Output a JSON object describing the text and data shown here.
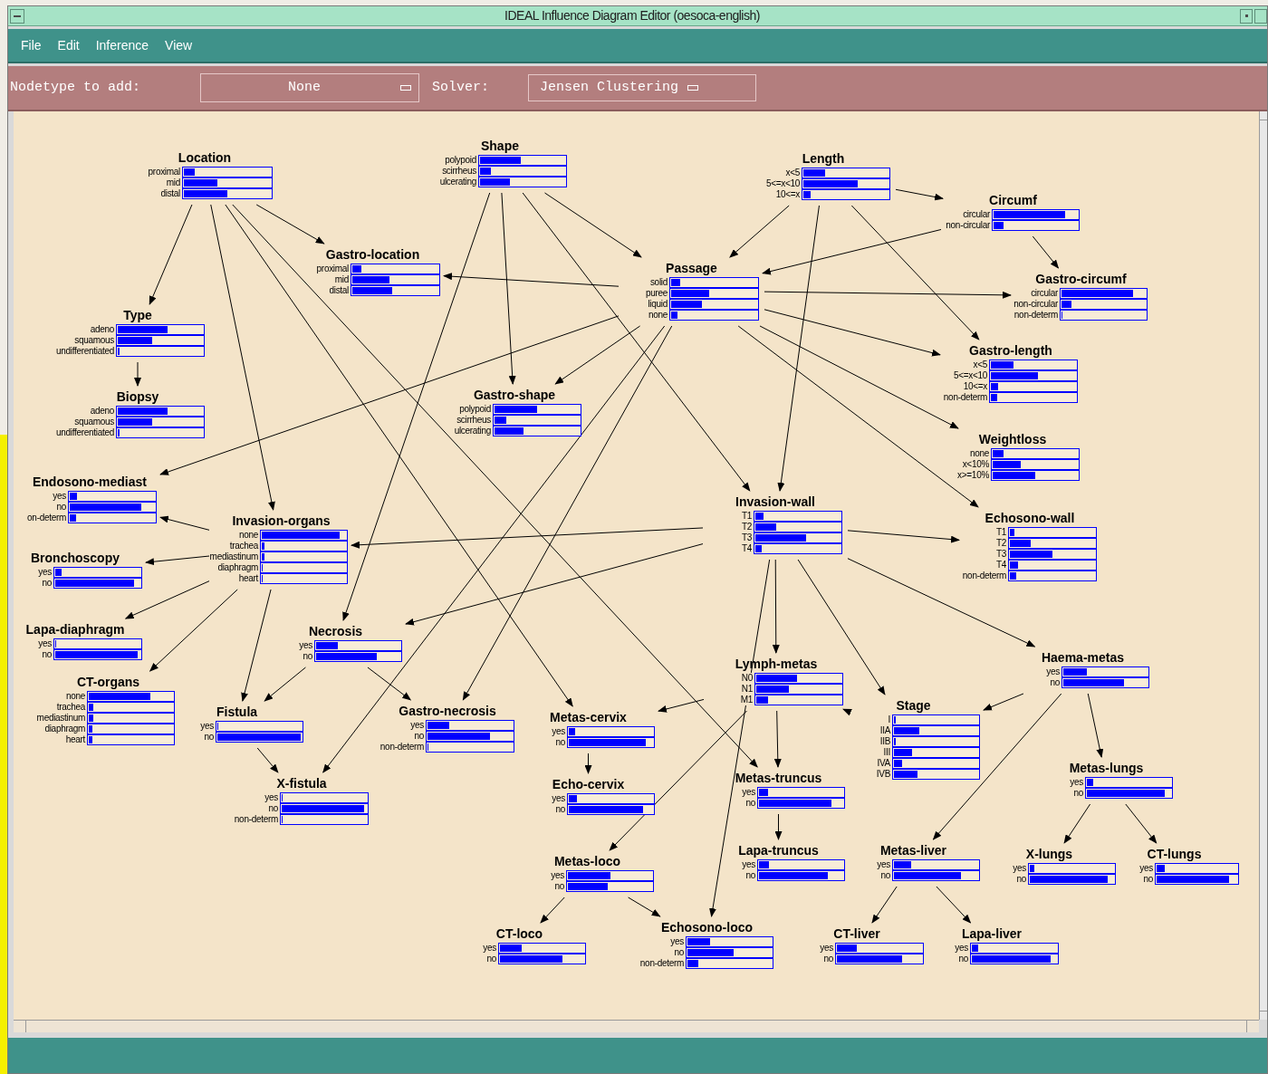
{
  "window": {
    "title": "IDEAL Influence Diagram Editor (oesoca-english)"
  },
  "menu": [
    "File",
    "Edit",
    "Inference",
    "View"
  ],
  "toolbar": {
    "nodetype_label": "Nodetype to add:",
    "nodetype_value": "None",
    "solver_label": "Solver:",
    "solver_value": "Jensen Clustering"
  },
  "nodes": [
    {
      "name": "Location",
      "states": [
        {
          "label": "proximal",
          "level": 0.12
        },
        {
          "label": "mid",
          "level": 0.39
        },
        {
          "label": "distal",
          "level": 0.5
        }
      ]
    },
    {
      "name": "Shape",
      "states": [
        {
          "label": "polypoid",
          "level": 0.48
        },
        {
          "label": "scirrheus",
          "level": 0.13
        },
        {
          "label": "ulcerating",
          "level": 0.35
        }
      ]
    },
    {
      "name": "Length",
      "states": [
        {
          "label": "x<5",
          "level": 0.25
        },
        {
          "label": "5<=x<10",
          "level": 0.64
        },
        {
          "label": "10<=x",
          "level": 0.09
        }
      ]
    },
    {
      "name": "Circumf",
      "states": [
        {
          "label": "circular",
          "level": 0.85
        },
        {
          "label": "non-circular",
          "level": 0.12
        }
      ]
    },
    {
      "name": "Gastro-location",
      "states": [
        {
          "label": "proximal",
          "level": 0.1
        },
        {
          "label": "mid",
          "level": 0.43
        },
        {
          "label": "distal",
          "level": 0.46
        }
      ]
    },
    {
      "name": "Type",
      "states": [
        {
          "label": "adeno",
          "level": 0.58
        },
        {
          "label": "squamous",
          "level": 0.4
        },
        {
          "label": "undifferentiated",
          "level": 0.02
        }
      ]
    },
    {
      "name": "Passage",
      "states": [
        {
          "label": "solid",
          "level": 0.1
        },
        {
          "label": "puree",
          "level": 0.44
        },
        {
          "label": "liquid",
          "level": 0.36
        },
        {
          "label": "none",
          "level": 0.07
        }
      ]
    },
    {
      "name": "Gastro-circumf",
      "states": [
        {
          "label": "circular",
          "level": 0.85
        },
        {
          "label": "non-circular",
          "level": 0.12
        },
        {
          "label": "non-determ",
          "level": 0.01
        }
      ]
    },
    {
      "name": "Biopsy",
      "states": [
        {
          "label": "adeno",
          "level": 0.58
        },
        {
          "label": "squamous",
          "level": 0.4
        },
        {
          "label": "undifferentiated",
          "level": 0.02
        }
      ]
    },
    {
      "name": "Gastro-shape",
      "states": [
        {
          "label": "polypoid",
          "level": 0.5
        },
        {
          "label": "scirrheus",
          "level": 0.14
        },
        {
          "label": "ulcerating",
          "level": 0.34
        }
      ]
    },
    {
      "name": "Gastro-length",
      "states": [
        {
          "label": "x<5",
          "level": 0.27
        },
        {
          "label": "5<=x<10",
          "level": 0.55
        },
        {
          "label": "10<=x",
          "level": 0.09
        },
        {
          "label": "non-determ",
          "level": 0.07
        }
      ]
    },
    {
      "name": "Endosono-mediast",
      "states": [
        {
          "label": "yes",
          "level": 0.08
        },
        {
          "label": "no",
          "level": 0.84
        },
        {
          "label": "on-determ",
          "level": 0.07
        }
      ]
    },
    {
      "name": "Weightloss",
      "states": [
        {
          "label": "none",
          "level": 0.13
        },
        {
          "label": "x<10%",
          "level": 0.33
        },
        {
          "label": "x>=10%",
          "level": 0.5
        }
      ]
    },
    {
      "name": "Bronchoscopy",
      "states": [
        {
          "label": "yes",
          "level": 0.07
        },
        {
          "label": "no",
          "level": 0.93
        }
      ]
    },
    {
      "name": "Invasion-organs",
      "states": [
        {
          "label": "none",
          "level": 0.92
        },
        {
          "label": "trachea",
          "level": 0.03
        },
        {
          "label": "mediastinum",
          "level": 0.03
        },
        {
          "label": "diaphragm",
          "level": 0.01
        },
        {
          "label": "heart",
          "level": 0.01
        }
      ]
    },
    {
      "name": "Invasion-wall",
      "states": [
        {
          "label": "T1",
          "level": 0.1
        },
        {
          "label": "T2",
          "level": 0.24
        },
        {
          "label": "T3",
          "level": 0.6
        },
        {
          "label": "T4",
          "level": 0.07
        }
      ]
    },
    {
      "name": "Echosono-wall",
      "states": [
        {
          "label": "T1",
          "level": 0.05
        },
        {
          "label": "T2",
          "level": 0.24
        },
        {
          "label": "T3",
          "level": 0.5
        },
        {
          "label": "T4",
          "level": 0.1
        },
        {
          "label": "non-determ",
          "level": 0.07
        }
      ]
    },
    {
      "name": "Lapa-diaphragm",
      "states": [
        {
          "label": "yes",
          "level": 0.01
        },
        {
          "label": "no",
          "level": 0.97
        }
      ]
    },
    {
      "name": "Necrosis",
      "states": [
        {
          "label": "yes",
          "level": 0.26
        },
        {
          "label": "no",
          "level": 0.72
        }
      ]
    },
    {
      "name": "CT-organs",
      "states": [
        {
          "label": "none",
          "level": 0.73
        },
        {
          "label": "trachea",
          "level": 0.05
        },
        {
          "label": "mediastinum",
          "level": 0.05
        },
        {
          "label": "diaphragm",
          "level": 0.04
        },
        {
          "label": "heart",
          "level": 0.04
        }
      ]
    },
    {
      "name": "Fistula",
      "states": [
        {
          "label": "yes",
          "level": 0.01
        },
        {
          "label": "no",
          "level": 0.99
        }
      ]
    },
    {
      "name": "Gastro-necrosis",
      "states": [
        {
          "label": "yes",
          "level": 0.26
        },
        {
          "label": "no",
          "level": 0.73
        },
        {
          "label": "non-determ",
          "level": 0.01
        }
      ]
    },
    {
      "name": "Lymph-metas",
      "states": [
        {
          "label": "N0",
          "level": 0.48
        },
        {
          "label": "N1",
          "level": 0.38
        },
        {
          "label": "M1",
          "level": 0.14
        }
      ]
    },
    {
      "name": "Haema-metas",
      "states": [
        {
          "label": "yes",
          "level": 0.28
        },
        {
          "label": "no",
          "level": 0.72
        }
      ]
    },
    {
      "name": "Metas-cervix",
      "states": [
        {
          "label": "yes",
          "level": 0.07
        },
        {
          "label": "no",
          "level": 0.91
        }
      ]
    },
    {
      "name": "X-fistula",
      "states": [
        {
          "label": "yes",
          "level": 0.01
        },
        {
          "label": "no",
          "level": 0.97
        },
        {
          "label": "non-determ",
          "level": 0.01
        }
      ]
    },
    {
      "name": "Echo-cervix",
      "states": [
        {
          "label": "yes",
          "level": 0.1
        },
        {
          "label": "no",
          "level": 0.88
        }
      ]
    },
    {
      "name": "Metas-truncus",
      "states": [
        {
          "label": "yes",
          "level": 0.11
        },
        {
          "label": "no",
          "level": 0.86
        }
      ]
    },
    {
      "name": "Stage",
      "states": [
        {
          "label": "I",
          "level": 0.02
        },
        {
          "label": "IIA",
          "level": 0.3
        },
        {
          "label": "IIB",
          "level": 0.02
        },
        {
          "label": "III",
          "level": 0.22
        },
        {
          "label": "IVA",
          "level": 0.1
        },
        {
          "label": "IVB",
          "level": 0.28
        }
      ]
    },
    {
      "name": "Metas-lungs",
      "states": [
        {
          "label": "yes",
          "level": 0.07
        },
        {
          "label": "no",
          "level": 0.93
        }
      ]
    },
    {
      "name": "Metas-loco",
      "states": [
        {
          "label": "yes",
          "level": 0.5
        },
        {
          "label": "no",
          "level": 0.47
        }
      ]
    },
    {
      "name": "Lapa-truncus",
      "states": [
        {
          "label": "yes",
          "level": 0.12
        },
        {
          "label": "no",
          "level": 0.82
        }
      ]
    },
    {
      "name": "Metas-liver",
      "states": [
        {
          "label": "yes",
          "level": 0.2
        },
        {
          "label": "no",
          "level": 0.8
        }
      ]
    },
    {
      "name": "X-lungs",
      "states": [
        {
          "label": "yes",
          "level": 0.05
        },
        {
          "label": "no",
          "level": 0.93
        }
      ]
    },
    {
      "name": "CT-lungs",
      "states": [
        {
          "label": "yes",
          "level": 0.1
        },
        {
          "label": "no",
          "level": 0.9
        }
      ]
    },
    {
      "name": "CT-loco",
      "states": [
        {
          "label": "yes",
          "level": 0.26
        },
        {
          "label": "no",
          "level": 0.74
        }
      ]
    },
    {
      "name": "Echosono-loco",
      "states": [
        {
          "label": "yes",
          "level": 0.27
        },
        {
          "label": "no",
          "level": 0.55
        },
        {
          "label": "non-determ",
          "level": 0.13
        }
      ]
    },
    {
      "name": "CT-liver",
      "states": [
        {
          "label": "yes",
          "level": 0.23
        },
        {
          "label": "no",
          "level": 0.77
        }
      ]
    },
    {
      "name": "Lapa-liver",
      "states": [
        {
          "label": "yes",
          "level": 0.07
        },
        {
          "label": "no",
          "level": 0.93
        }
      ]
    }
  ]
}
